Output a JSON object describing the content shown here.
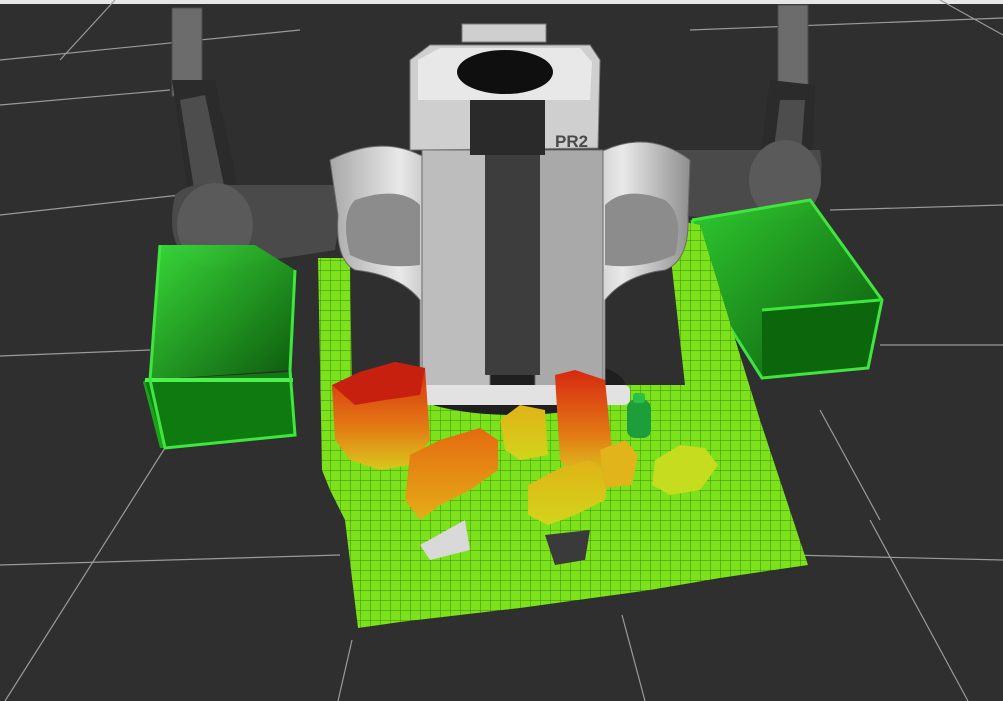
{
  "app": {
    "robot_label": "PR2"
  },
  "colors": {
    "background": "#2f2f2f",
    "grid": "#9a9a9a",
    "floor_voxel": "#7be21c",
    "bin_green": "#1fb31f",
    "robot_dark": "#3a3a3a",
    "robot_light": "#d8d8d8",
    "voxel_red": "#d72812",
    "voxel_orange": "#e88a10",
    "voxel_yellow": "#d6c81c",
    "voxel_lime": "#c3dc1e"
  },
  "objects": {
    "left_bin": "left-drop-box",
    "right_bin": "right-drop-box",
    "bottle": "green-bottle"
  }
}
